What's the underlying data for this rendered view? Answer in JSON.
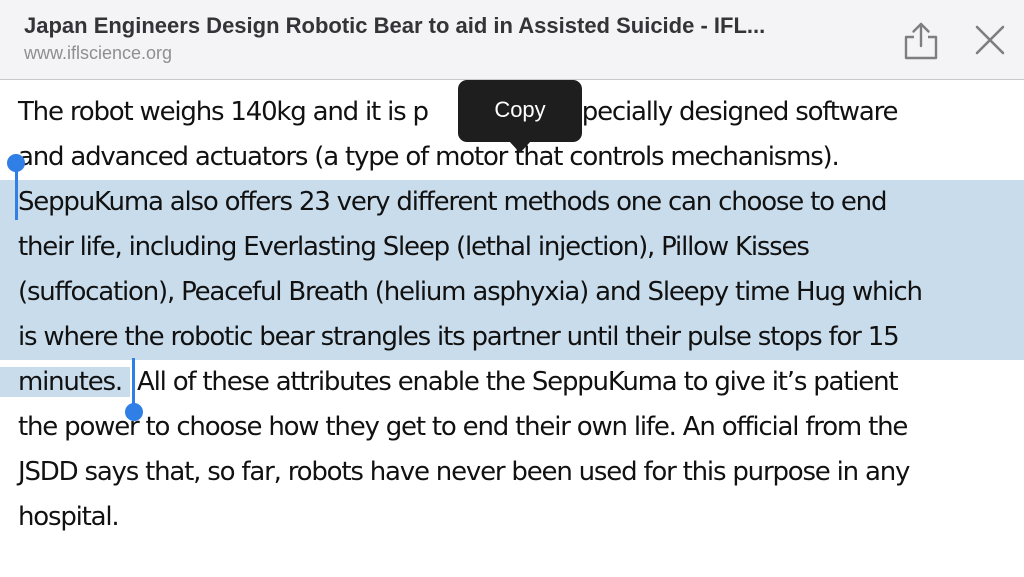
{
  "header": {
    "title": "Japan Engineers Design Robotic Bear to aid in Assisted Suicide - IFL...",
    "url": "www.iflscience.org",
    "share_icon": "share-icon",
    "close_icon": "close-icon"
  },
  "article": {
    "line1_a": "The robot weighs 140kg and it is p",
    "line1_b": "by specially designed software",
    "line2": "and advanced actuators (a type of motor that controls mechanisms).",
    "line3": "SeppuKuma also offers 23 very different methods one can choose to end",
    "line4": "their life, including Everlasting Sleep (lethal injection), Pillow Kisses",
    "line5": "(suffocation), Peaceful Breath (helium asphyxia) and Sleepy time Hug which",
    "line6": "is where the robotic bear strangles its partner until their pulse stops for 15",
    "line7_selected": "minutes.",
    "line7_rest": "All of these attributes enable the SeppuKuma to give it’s patient",
    "line8": "the power to choose how they get to end their own life. An official from the",
    "line9": "JSDD says that, so far, robots have never been used for this purpose in any",
    "line10": "hospital."
  },
  "callout": {
    "copy_label": "Copy"
  },
  "colors": {
    "selection": "#c9dcec",
    "handle": "#2f7fe6",
    "callout_bg": "#1e1e1e",
    "header_bg": "#f4f4f6"
  }
}
